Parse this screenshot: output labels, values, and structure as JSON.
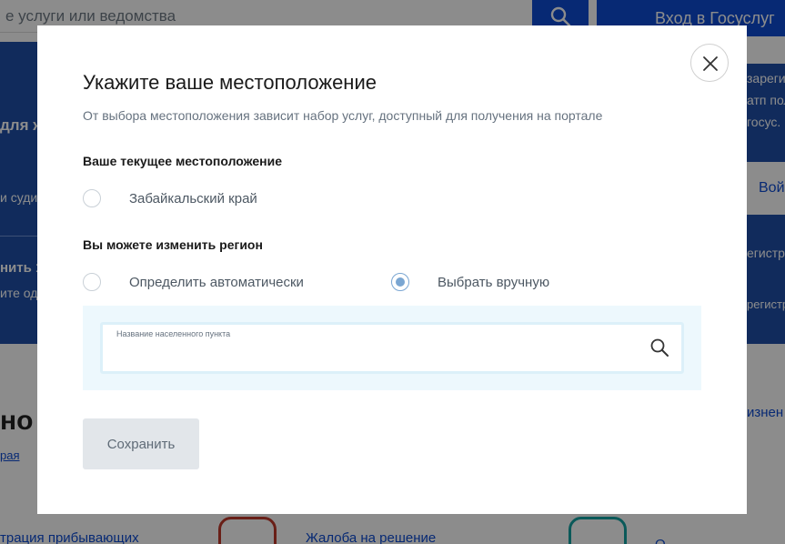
{
  "background": {
    "search_placeholder": "е услуги или ведомства",
    "login_label": "Вход в Госуслуг",
    "banner_title": "для ж",
    "banner_text_1": "и суди",
    "banner_title_2": "нить 1",
    "banner_text_2": "ите од",
    "right_lines": [
      "зареги",
      "атп пол",
      "госус."
    ],
    "right_button": "Вой",
    "right_reg_1": "егистри",
    "right_reg_2": "регистр",
    "bottom_heading": "но",
    "bottom_link": "рая",
    "bottom_right_link": "изнен",
    "bottom_item_1": "трация прибывающих",
    "bottom_item_2": "Жалоба на решение",
    "bottom_item_3": "Ο"
  },
  "modal": {
    "title": "Укажите ваше местоположение",
    "subtitle": "От выбора местоположения зависит набор услуг, доступный для получения на портале",
    "current_section": "Ваше текущее местоположение",
    "current_region": "Забайкальский край",
    "change_section": "Вы можете изменить регион",
    "option_auto": "Определить автоматически",
    "option_manual": "Выбрать вручную",
    "selected_option": "manual",
    "field_label": "Название населенного пункта",
    "field_value": "",
    "save_label": "Сохранить",
    "close_icon": "close-icon",
    "search_icon": "search-icon"
  },
  "colors": {
    "accent": "#0d4cd3",
    "radio_checked": "#7aa6d2",
    "panel_bg": "#edf8fd",
    "button_disabled": "#e2e6ea"
  }
}
